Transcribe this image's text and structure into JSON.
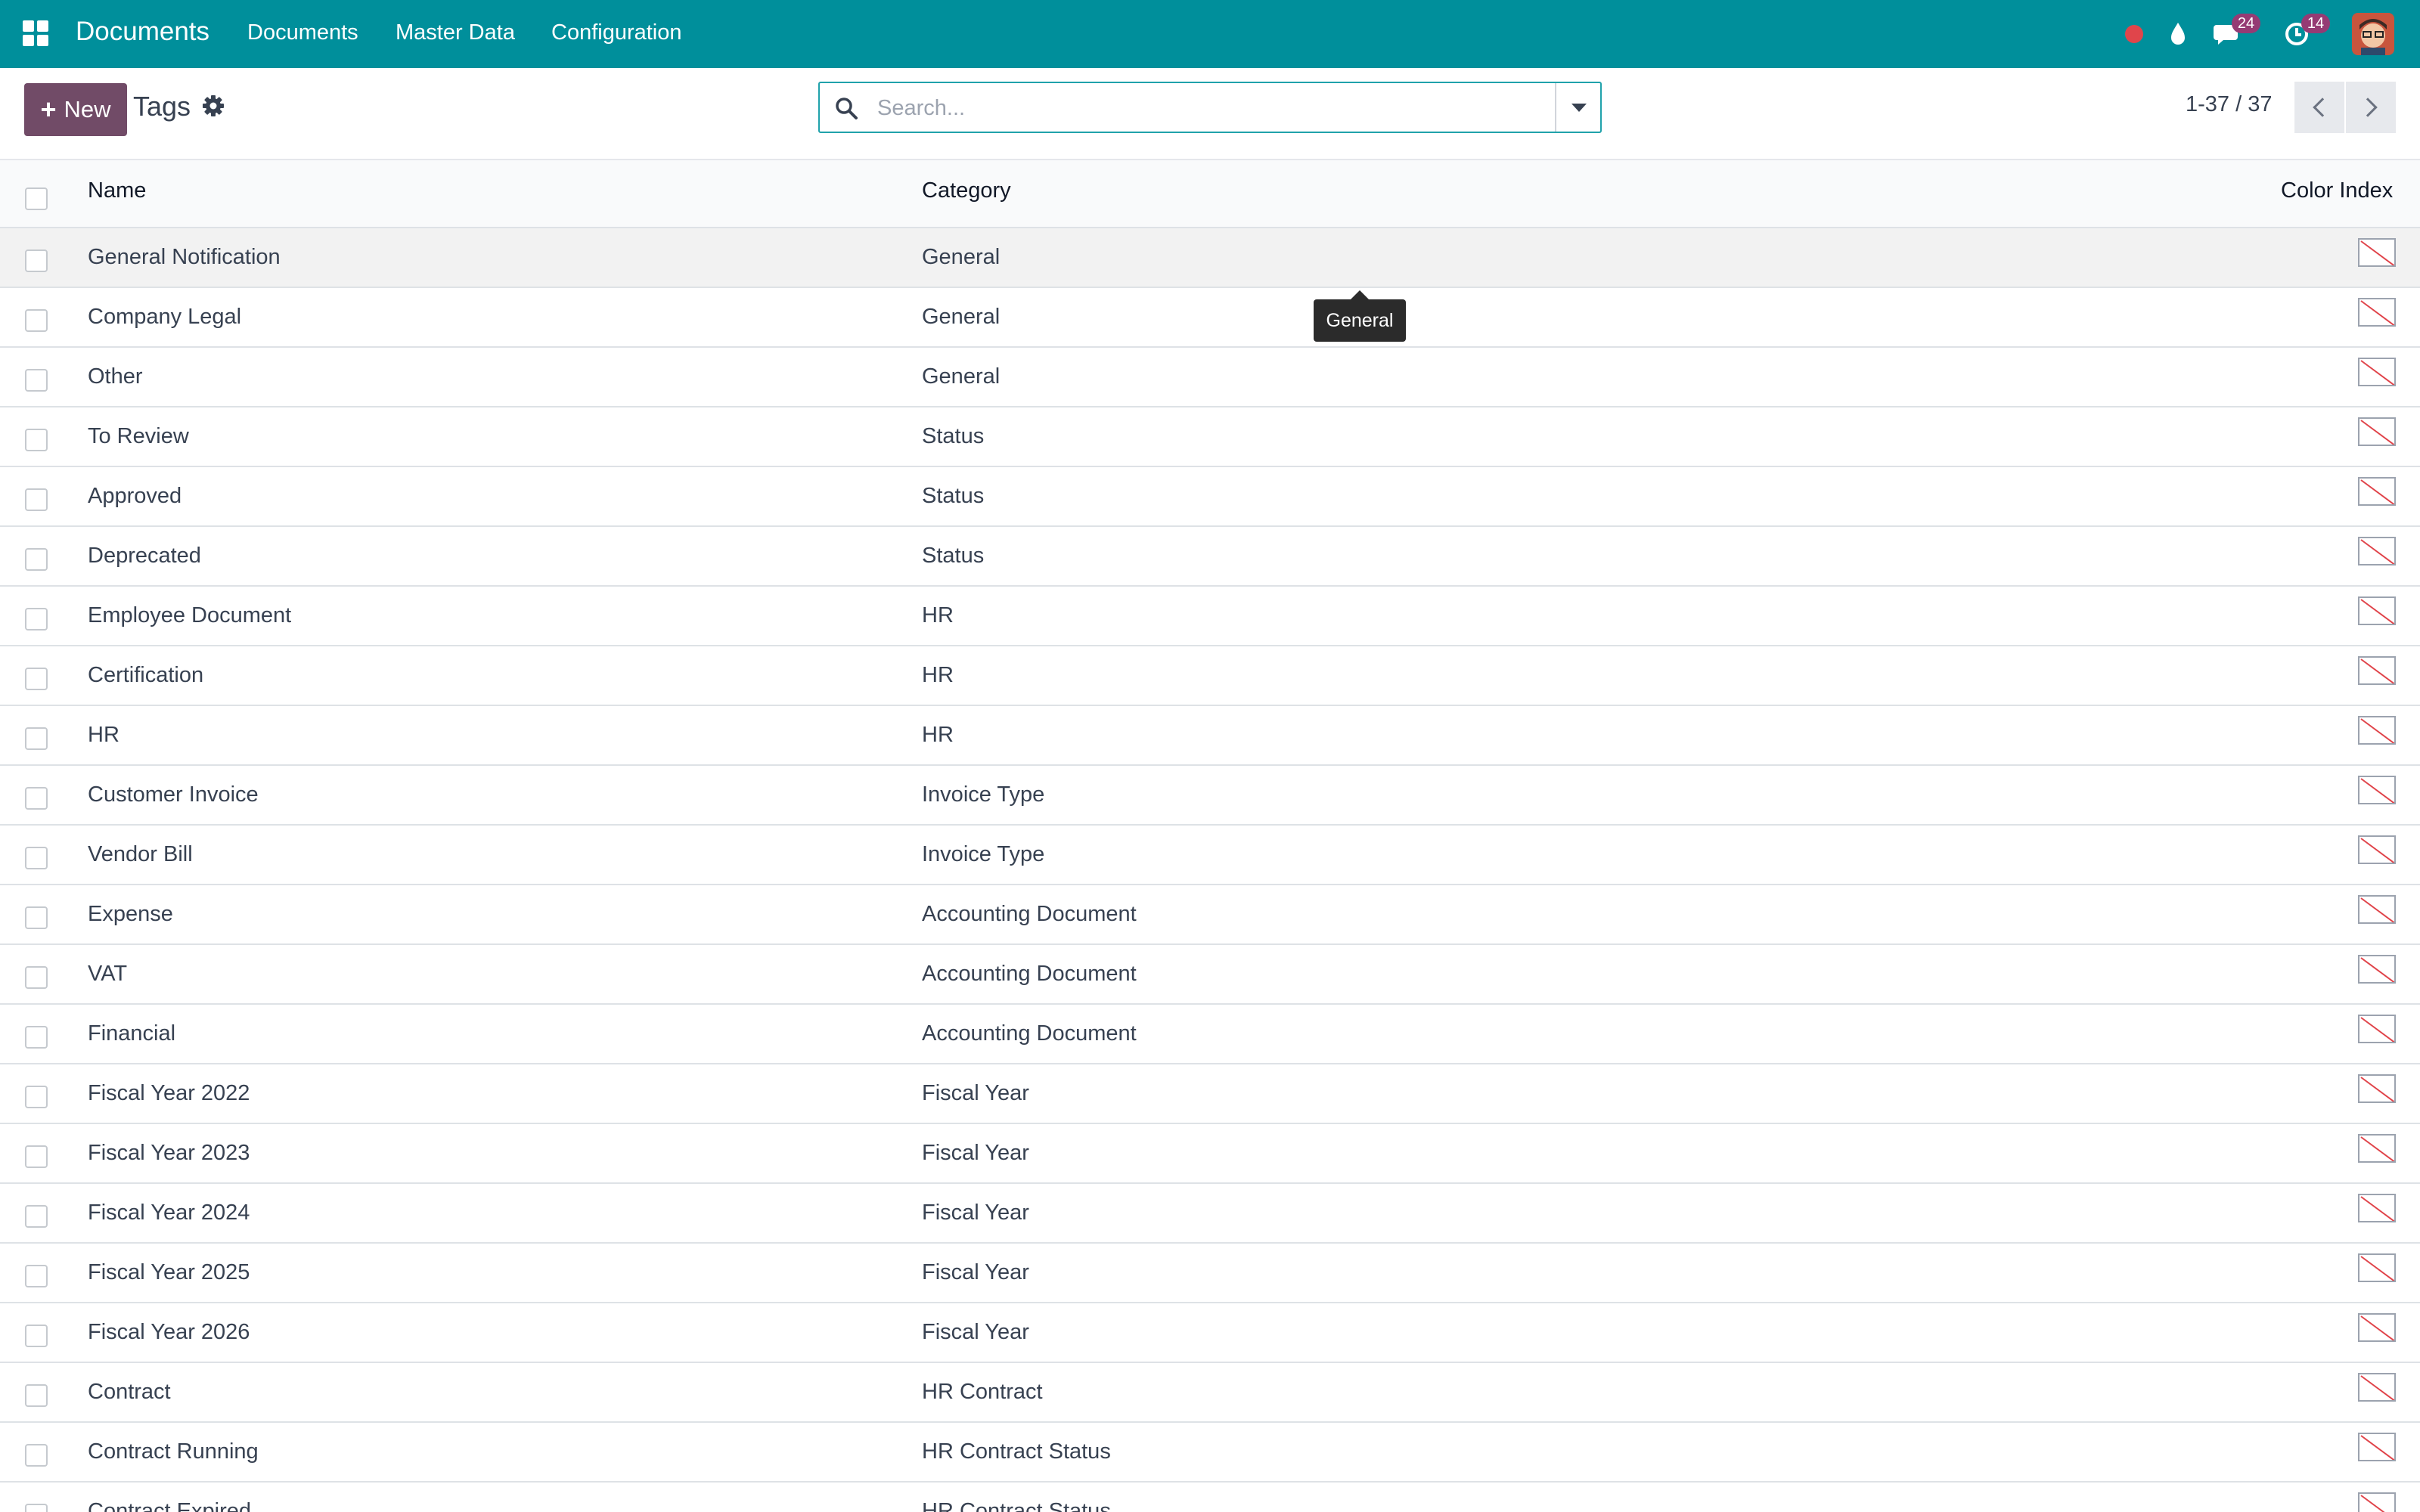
{
  "navbar": {
    "brand": "Documents",
    "menu": [
      "Documents",
      "Master Data",
      "Configuration"
    ],
    "messages_badge": "24",
    "activities_badge": "14",
    "accent_color": "#008f9b"
  },
  "control_panel": {
    "new_label": "New",
    "title": "Tags",
    "search_placeholder": "Search...",
    "pager": "1-37 / 37",
    "button_color": "#714b67"
  },
  "table": {
    "headers": {
      "name": "Name",
      "category": "Category",
      "color_index": "Color Index"
    },
    "rows": [
      {
        "name": "General Notification",
        "category": "General"
      },
      {
        "name": "Company Legal",
        "category": "General"
      },
      {
        "name": "Other",
        "category": "General"
      },
      {
        "name": "To Review",
        "category": "Status"
      },
      {
        "name": "Approved",
        "category": "Status"
      },
      {
        "name": "Deprecated",
        "category": "Status"
      },
      {
        "name": "Employee Document",
        "category": "HR"
      },
      {
        "name": "Certification",
        "category": "HR"
      },
      {
        "name": "HR",
        "category": "HR"
      },
      {
        "name": "Customer Invoice",
        "category": "Invoice Type"
      },
      {
        "name": "Vendor Bill",
        "category": "Invoice Type"
      },
      {
        "name": "Expense",
        "category": "Accounting Document"
      },
      {
        "name": "VAT",
        "category": "Accounting Document"
      },
      {
        "name": "Financial",
        "category": "Accounting Document"
      },
      {
        "name": "Fiscal Year 2022",
        "category": "Fiscal Year"
      },
      {
        "name": "Fiscal Year 2023",
        "category": "Fiscal Year"
      },
      {
        "name": "Fiscal Year 2024",
        "category": "Fiscal Year"
      },
      {
        "name": "Fiscal Year 2025",
        "category": "Fiscal Year"
      },
      {
        "name": "Fiscal Year 2026",
        "category": "Fiscal Year"
      },
      {
        "name": "Contract",
        "category": "HR Contract"
      },
      {
        "name": "Contract Running",
        "category": "HR Contract Status"
      },
      {
        "name": "Contract Expired",
        "category": "HR Contract Status"
      }
    ]
  },
  "tooltip": {
    "text": "General"
  }
}
